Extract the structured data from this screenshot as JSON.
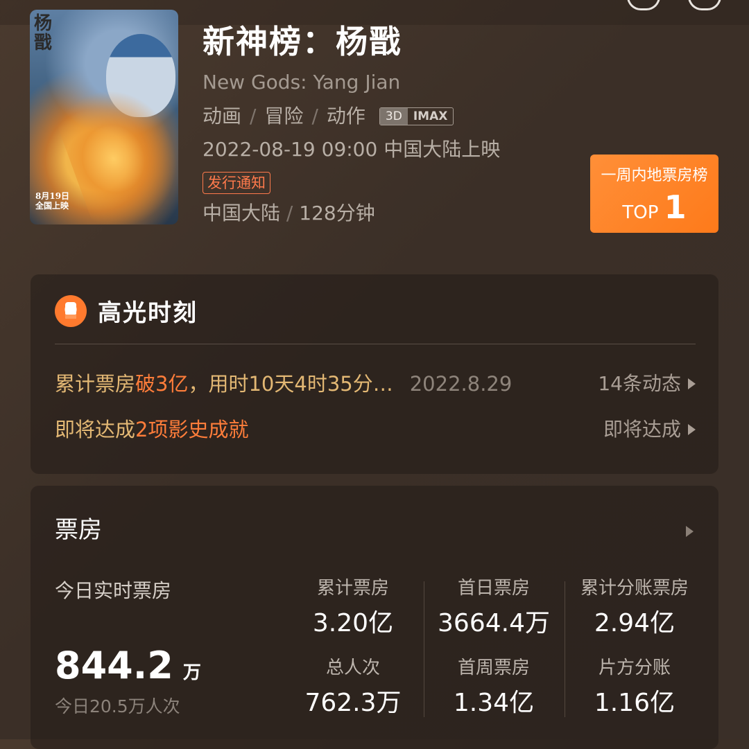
{
  "movie": {
    "title": "新神榜：杨戬",
    "english_title": "New Gods: Yang Jian",
    "genres": [
      "动画",
      "冒险",
      "动作"
    ],
    "formats": [
      "3D",
      "IMAX"
    ],
    "release": "2022-08-19 09:00 中国大陆上映",
    "notice_label": "发行通知",
    "region": "中国大陆",
    "duration": "128分钟",
    "poster": {
      "vertical_title": "杨戬",
      "date_line1": "8月19日",
      "date_line2": "全国上映"
    }
  },
  "rank_badge": {
    "label": "一周内地票房榜",
    "top_prefix": "TOP",
    "rank": "1"
  },
  "highlights": {
    "title": "高光时刻",
    "row1": {
      "prefix": "累计票房 ",
      "emphasis": "破3亿",
      "suffix": "，用时10天4时35分…",
      "date": "2022.8.29",
      "more": "14条动态"
    },
    "row2": {
      "prefix": "即将达成 ",
      "emphasis": "2项影史成就",
      "more": "即将达成"
    }
  },
  "box_office": {
    "title": "票房",
    "today_label": "今日实时票房",
    "today_value": "844.2",
    "today_unit": "万",
    "today_sub": "今日20.5万人次",
    "stats": [
      {
        "label": "累计票房",
        "value": "3.20亿"
      },
      {
        "label": "首日票房",
        "value": "3664.4万"
      },
      {
        "label": "累计分账票房",
        "value": "2.94亿"
      },
      {
        "label": "总人次",
        "value": "762.3万"
      },
      {
        "label": "首周票房",
        "value": "1.34亿"
      },
      {
        "label": "片方分账",
        "value": "1.16亿"
      }
    ]
  },
  "colors": {
    "accent": "#ff7d3a",
    "gold_text": "#e3b874",
    "badge_orange": "#fe7a1a"
  }
}
